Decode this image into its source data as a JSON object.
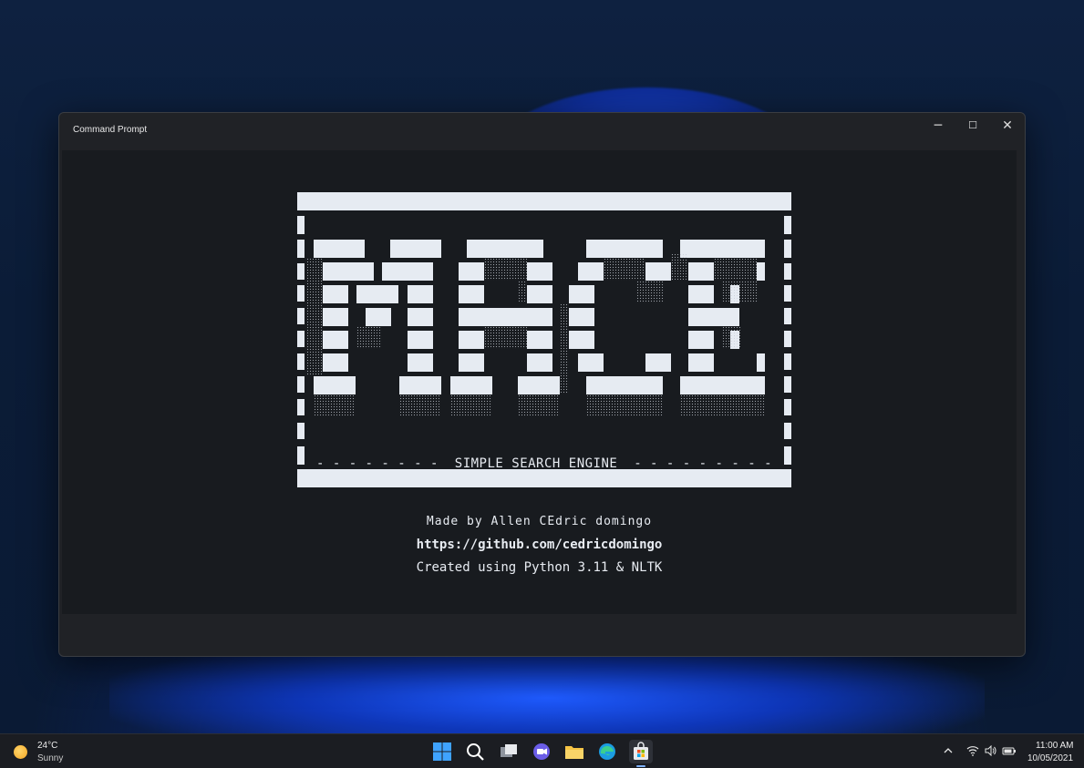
{
  "window": {
    "title": "Command Prompt",
    "minimize_glyph": "─",
    "maximize_glyph": "☐",
    "close_glyph": "✕"
  },
  "banner": {
    "tagline": "- - - - - - - -  SIMPLE SEARCH ENGINE  - - - - - - - - -",
    "logo_text": "MACE"
  },
  "credits": {
    "made_by": "Made by Allen CEdric domingo",
    "github": "https://github.com/cedricdomingo",
    "created_with": "Created using Python 3.11 & NLTK"
  },
  "taskbar": {
    "weather_temp": "24°C",
    "weather_desc": "Sunny",
    "apps": [
      "start-icon",
      "search-icon",
      "task-view-icon",
      "chat-icon",
      "file-explorer-icon",
      "edge-icon",
      "store-icon"
    ],
    "clock_time": "11:00 AM",
    "clock_date": "10/05/2021"
  },
  "colors": {
    "terminal_bg": "#181b1f",
    "window_bg": "#202226",
    "banner_fg": "#e6ebf2",
    "accent": "#7fb2ff"
  }
}
